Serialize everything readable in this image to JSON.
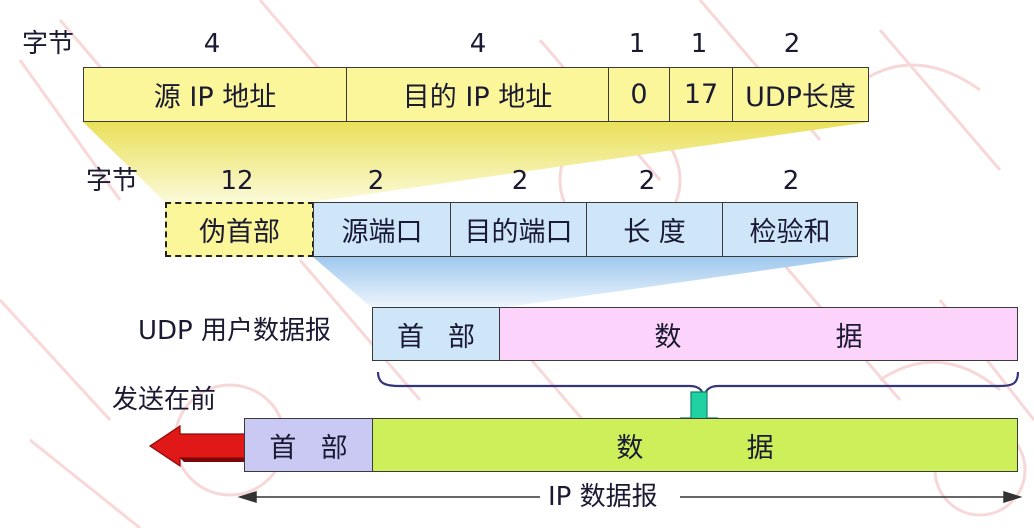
{
  "ip_header": {
    "bytes_label": "字节",
    "byte_counts": [
      "4",
      "4",
      "1",
      "1",
      "2"
    ],
    "fields": [
      "源 IP 地址",
      "目的 IP 地址",
      "0",
      "17",
      "UDP长度"
    ]
  },
  "udp_header": {
    "bytes_label": "字节",
    "byte_counts": [
      "12",
      "2",
      "2",
      "2",
      "2"
    ],
    "pseudo_header": "伪首部",
    "fields": [
      "源端口",
      "目的端口",
      "长 度",
      "检验和"
    ]
  },
  "udp_datagram": {
    "label": "UDP 用户数据报",
    "header_left": "首",
    "header_right": "部",
    "data_left": "数",
    "data_right": "据"
  },
  "ip_datagram": {
    "send_first_label": "发送在前",
    "header_left": "首",
    "header_right": "部",
    "data_left": "数",
    "data_right": "据",
    "span_label": "IP 数据报"
  },
  "colors": {
    "ip_header_fill": "#fbf69a",
    "udp_header_fill": "#cfe6f8",
    "udp_data_fill": "#fcd4fb",
    "ip_header_box_fill": "#c9c9f3",
    "ip_data_fill": "#cdf05a",
    "send_arrow": "#e01818",
    "down_arrow": "#1fd0a0",
    "watermark": "#f0b0b0"
  },
  "icons": {
    "send_arrow": "left-arrow-icon",
    "down_arrow": "down-arrow-icon"
  }
}
